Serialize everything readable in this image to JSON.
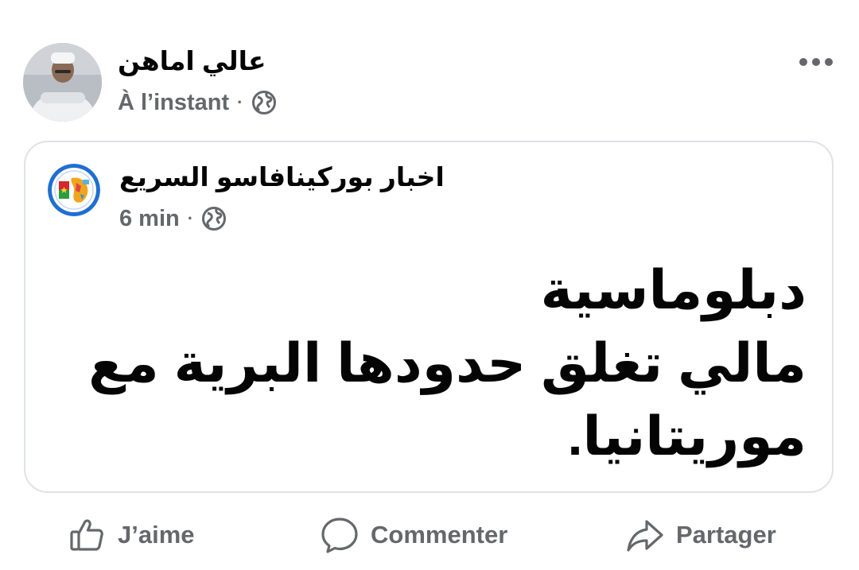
{
  "post": {
    "author_name": "عالي اماهن",
    "timestamp": "À l’instant",
    "separator": "·",
    "audience_icon": "globe-icon",
    "more_icon": "more-options-icon"
  },
  "shared_post": {
    "page_name": "اخبار بوركينافاسو السريع",
    "timestamp": "6 min",
    "separator": "·",
    "audience_icon": "globe-icon",
    "text_lines": [
      "دبلوماسية",
      "مالي تغلق حدودها البرية مع",
      "موريتانيا."
    ]
  },
  "actions": {
    "like_label": "J’aime",
    "like_icon": "thumbs-up-icon",
    "comment_label": "Commenter",
    "comment_icon": "speech-bubble-icon",
    "share_label": "Partager",
    "share_icon": "share-arrow-icon"
  },
  "colors": {
    "primary_text": "#050505",
    "secondary_text": "#65676b",
    "card_border": "#e0e2e6"
  }
}
